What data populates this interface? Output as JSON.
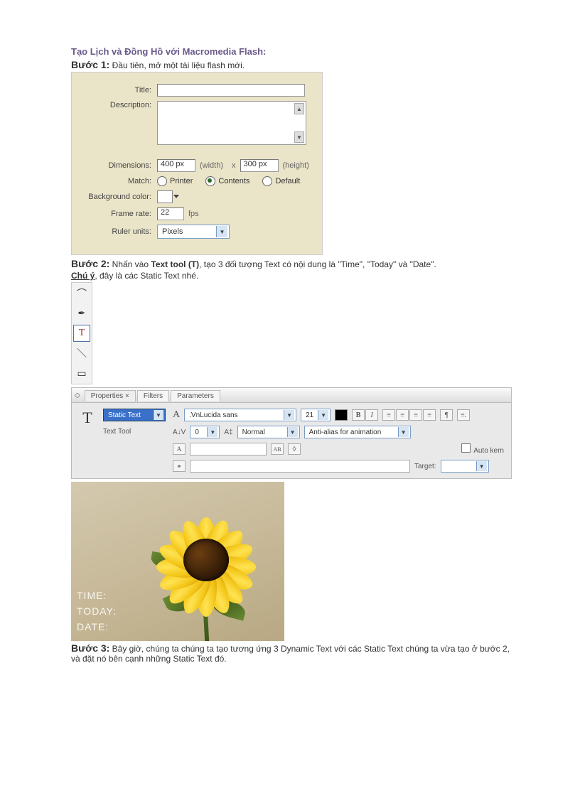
{
  "heading": "Tạo Lịch và Đồng Hồ với Macromedia Flash:",
  "step1": {
    "label": "Bước 1:",
    "text": " Đầu tiên, mở một tài liệu flash mới."
  },
  "dialog": {
    "title_label": "Title:",
    "desc_label": "Description:",
    "dim_label": "Dimensions:",
    "width_val": "400 px",
    "width_unit": "(width)",
    "x": "x",
    "height_val": "300 px",
    "height_unit": "(height)",
    "match_label": "Match:",
    "match_printer": "Printer",
    "match_contents": "Contents",
    "match_default": "Default",
    "bg_label": "Background color:",
    "framerate_label": "Frame rate:",
    "framerate_val": "22",
    "fps": "fps",
    "ruler_label": "Ruler units:",
    "ruler_val": "Pixels"
  },
  "step2": {
    "label": "Bước 2:",
    "pre": " Nhấn vào ",
    "tool": "Text tool (T)",
    "post": ", tạo 3 đối tượng Text có nội dung là \"Time\", \"Today\" và \"Date\".",
    "note_label": "Chú ý",
    "note_text": ", đây là các Static Text nhé."
  },
  "prop": {
    "tab_properties": "Properties",
    "tab_filters": "Filters",
    "tab_parameters": "Parameters",
    "static_text": "Static Text",
    "text_tool": "Text Tool",
    "font": ".VnLucida sans",
    "size": "21",
    "av_val": "0",
    "mode": "Normal",
    "aa": "Anti-alias for animation",
    "auto_kern": "Auto kern",
    "target": "Target:"
  },
  "overlay": {
    "time": "TIME:",
    "today": "TODAY:",
    "date": "DATE:"
  },
  "step3": {
    "label": "Bước 3:",
    "text": " Bây giờ, chúng ta chúng ta tạo tương ứng 3 Dynamic Text với các Static Text chúng ta vừa tạo ở bước 2, và đặt nó bên cạnh những Static Text đó."
  }
}
